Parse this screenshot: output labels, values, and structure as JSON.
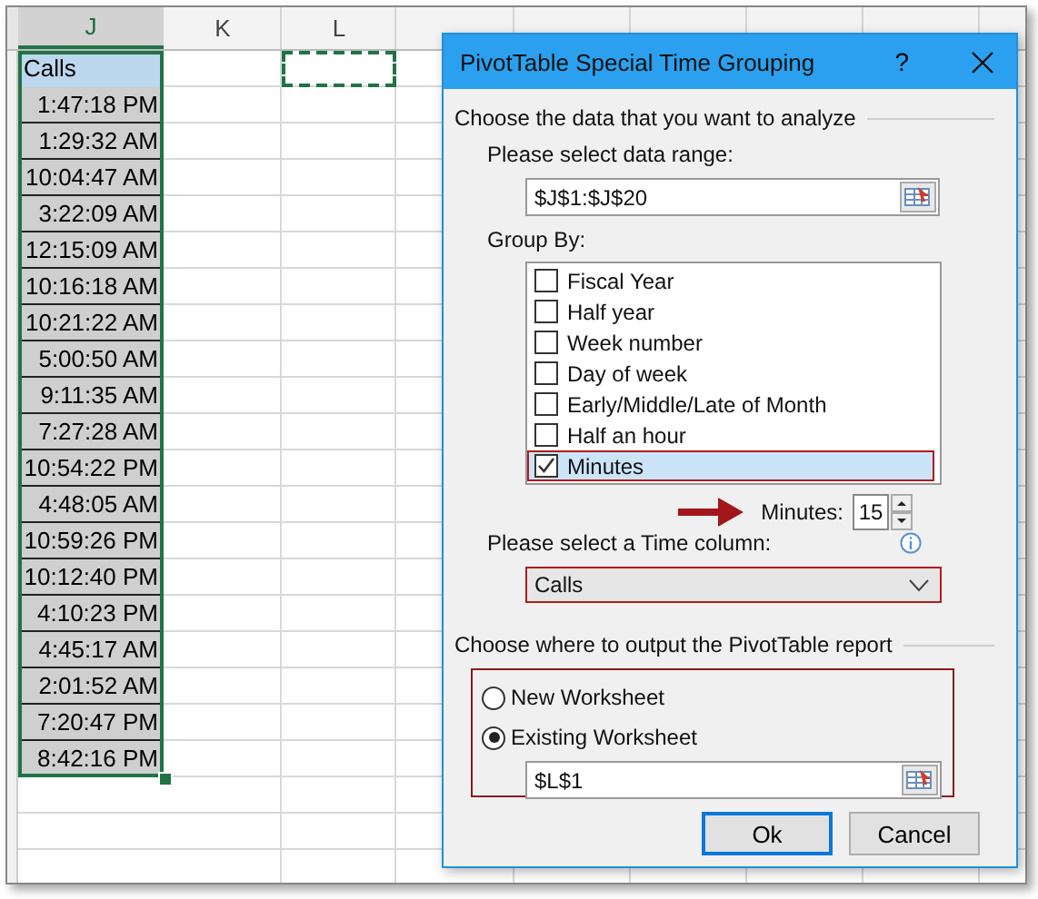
{
  "sheet": {
    "columns": [
      {
        "label": "J",
        "selected": true
      },
      {
        "label": "K",
        "selected": false
      },
      {
        "label": "L",
        "selected": false
      }
    ],
    "rows": [
      {
        "value": "Calls",
        "kind": "header",
        "marquee": true
      },
      {
        "value": "1:47:18 PM",
        "kind": "time",
        "marquee": false
      },
      {
        "value": "1:29:32 AM",
        "kind": "time",
        "marquee": false
      },
      {
        "value": "10:04:47 AM",
        "kind": "time",
        "marquee": false
      },
      {
        "value": "3:22:09 AM",
        "kind": "time",
        "marquee": false
      },
      {
        "value": "12:15:09 AM",
        "kind": "time",
        "marquee": false
      },
      {
        "value": "10:16:18 AM",
        "kind": "time",
        "marquee": false
      },
      {
        "value": "10:21:22 AM",
        "kind": "time",
        "marquee": false
      },
      {
        "value": "5:00:50 AM",
        "kind": "time",
        "marquee": false
      },
      {
        "value": "9:11:35 AM",
        "kind": "time",
        "marquee": false
      },
      {
        "value": "7:27:28 AM",
        "kind": "time",
        "marquee": false
      },
      {
        "value": "10:54:22 PM",
        "kind": "time",
        "marquee": false
      },
      {
        "value": "4:48:05 AM",
        "kind": "time",
        "marquee": false
      },
      {
        "value": "10:59:26 PM",
        "kind": "time",
        "marquee": false
      },
      {
        "value": "10:12:40 PM",
        "kind": "time",
        "marquee": false
      },
      {
        "value": "4:10:23 PM",
        "kind": "time",
        "marquee": false
      },
      {
        "value": "4:45:17 AM",
        "kind": "time",
        "marquee": false
      },
      {
        "value": "2:01:52 AM",
        "kind": "time",
        "marquee": false
      },
      {
        "value": "7:20:47 PM",
        "kind": "time",
        "marquee": false
      },
      {
        "value": "8:42:16 PM",
        "kind": "time",
        "marquee": false
      }
    ]
  },
  "dialog": {
    "title": "PivotTable Special Time Grouping",
    "help": "?",
    "data_section": {
      "label": "Choose the data that you want to analyze",
      "range_label": "Please select data range:",
      "range_value": "$J$1:$J$20"
    },
    "group_by": {
      "label": "Group By:",
      "items": [
        {
          "label": "Fiscal Year",
          "checked": false,
          "selected": false
        },
        {
          "label": "Half year",
          "checked": false,
          "selected": false
        },
        {
          "label": "Week number",
          "checked": false,
          "selected": false
        },
        {
          "label": "Day of week",
          "checked": false,
          "selected": false
        },
        {
          "label": "Early/Middle/Late of Month",
          "checked": false,
          "selected": false
        },
        {
          "label": "Half an hour",
          "checked": false,
          "selected": false
        },
        {
          "label": "Minutes",
          "checked": true,
          "selected": true
        }
      ]
    },
    "minutes": {
      "label": "Minutes:",
      "value": "15"
    },
    "time_column": {
      "label": "Please select a Time column:",
      "value": "Calls"
    },
    "output_section": {
      "label": "Choose where to output the PivotTable report",
      "options": [
        {
          "label": "New Worksheet",
          "selected": false
        },
        {
          "label": "Existing Worksheet",
          "selected": true
        }
      ],
      "location_value": "$L$1"
    },
    "buttons": [
      {
        "label": "Ok",
        "default": true
      },
      {
        "label": "Cancel",
        "default": false
      }
    ]
  }
}
